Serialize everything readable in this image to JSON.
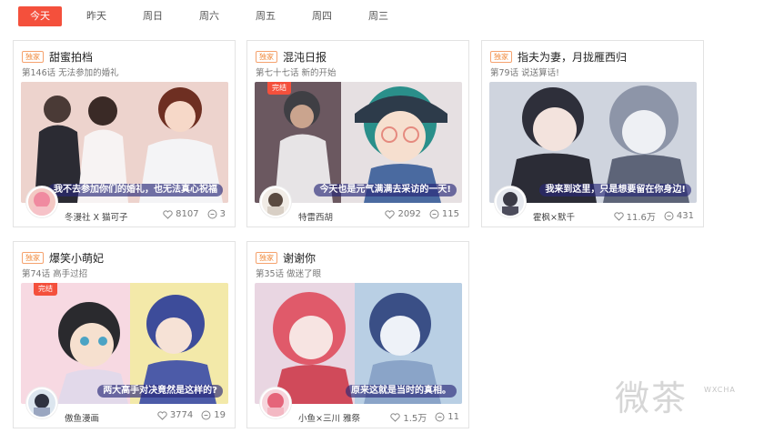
{
  "tabs": [
    {
      "label": "今天",
      "active": true
    },
    {
      "label": "昨天",
      "active": false
    },
    {
      "label": "周日",
      "active": false
    },
    {
      "label": "周六",
      "active": false
    },
    {
      "label": "周五",
      "active": false
    },
    {
      "label": "周四",
      "active": false
    },
    {
      "label": "周三",
      "active": false
    }
  ],
  "cards": [
    {
      "badge": "独家",
      "title": "甜蜜拍档",
      "subtitle": "第146话 无法参加的婚礼",
      "caption": "我不去参加你们的婚礼，也无法真心祝福",
      "status": "",
      "author": "冬漫社 X 猫可子",
      "likes": "8107",
      "comments": "3"
    },
    {
      "badge": "独家",
      "title": "混沌日报",
      "subtitle": "第七十七话 新的开始",
      "caption": "今天也是元气满满去采访的一天!",
      "status": "完结",
      "author": "特雷西胡",
      "likes": "2092",
      "comments": "115"
    },
    {
      "badge": "独家",
      "title": "指夫为妻，月拢雁西归",
      "subtitle": "第79话 说送算话!",
      "caption": "我来到这里，只是想要留在你身边!",
      "status": "",
      "author": "霍枫×默千",
      "likes": "11.6万",
      "comments": "431"
    },
    {
      "badge": "独家",
      "title": "爆笑小萌妃",
      "subtitle": "第74话 高手过招",
      "caption": "两大高手对决竟然是这样的?",
      "status": "完结",
      "author": "傲鱼漫画",
      "likes": "3774",
      "comments": "19"
    },
    {
      "badge": "独家",
      "title": "谢谢你",
      "subtitle": "第35话 做迷了眼",
      "caption": "原来这就是当时的真相。",
      "status": "",
      "author": "小鱼×三川 雅祭",
      "likes": "1.5万",
      "comments": "11"
    }
  ],
  "icons": {
    "like": "heart-icon",
    "comment": "comment-bubble-icon"
  },
  "watermark": {
    "text": "微茶",
    "sub": "WXCHA"
  },
  "colors": {
    "accent": "#f4503c",
    "badge": "#f08a3c"
  }
}
